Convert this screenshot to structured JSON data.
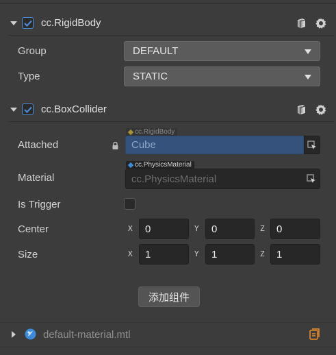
{
  "rigidbody": {
    "title": "cc.RigidBody",
    "group_label": "Group",
    "group_value": "DEFAULT",
    "type_label": "Type",
    "type_value": "STATIC"
  },
  "boxcollider": {
    "title": "cc.BoxCollider",
    "attached_label": "Attached",
    "attached_tag": "cc.RigidBody",
    "attached_value": "Cube",
    "material_label": "Material",
    "material_tag": "cc.PhysicsMaterial",
    "material_value": "cc.PhysicsMaterial",
    "trigger_label": "Is Trigger",
    "center_label": "Center",
    "center": {
      "x_axis": "X",
      "x": "0",
      "y_axis": "Y",
      "y": "0",
      "z_axis": "Z",
      "z": "0"
    },
    "size_label": "Size",
    "size": {
      "x_axis": "X",
      "x": "1",
      "y_axis": "Y",
      "y": "1",
      "z_axis": "Z",
      "z": "1"
    }
  },
  "add_component_label": "添加组件",
  "material_asset": {
    "name": "default-material.mtl"
  },
  "colors": {
    "checkbox_accent": "#4f8ad6",
    "asset_icon": "#3d8bd8",
    "asset_action": "#e8892a"
  }
}
